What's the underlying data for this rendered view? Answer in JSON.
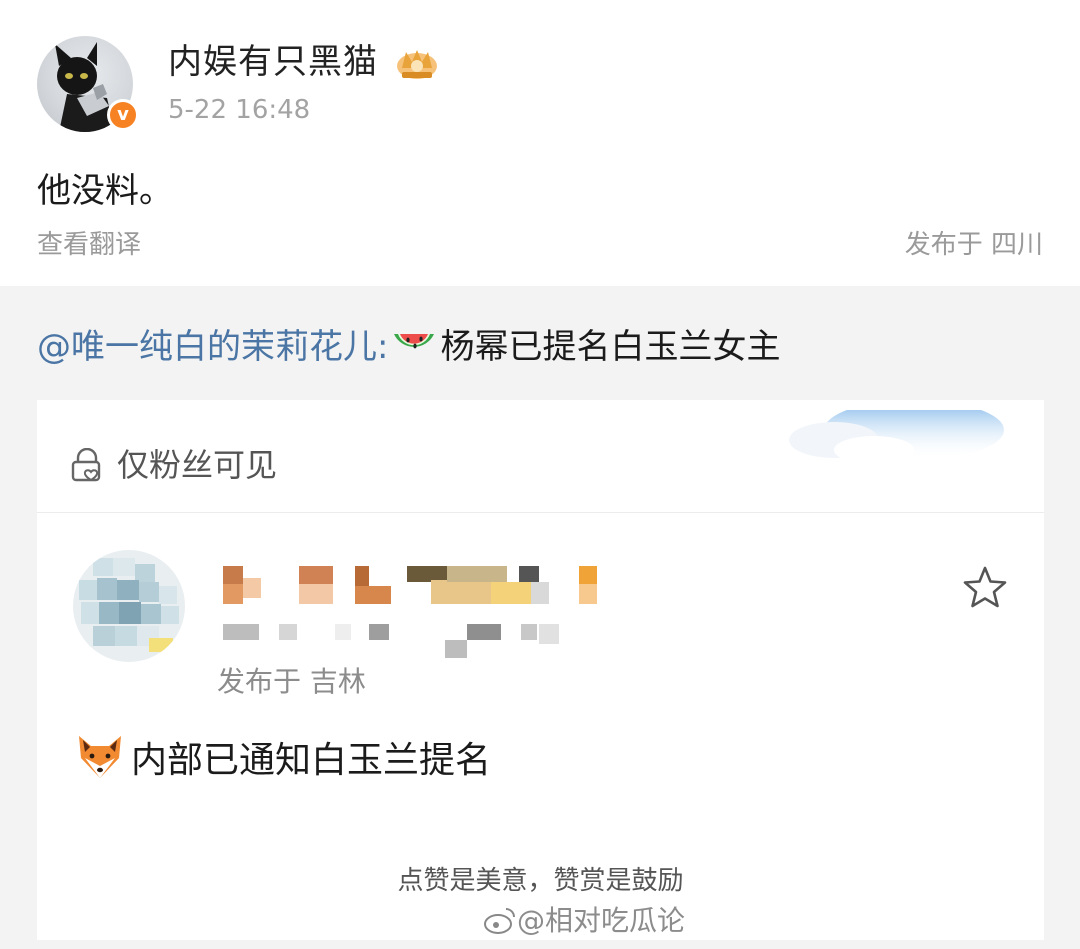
{
  "post": {
    "username": "内娱有只黑猫",
    "time": "5-22 16:48",
    "badge": "v",
    "text": "他没料。",
    "translate": "查看翻译",
    "location": "发布于 四川"
  },
  "repost": {
    "mention": "@唯一纯白的茉莉花儿:",
    "text": "杨幂已提名白玉兰女主"
  },
  "card": {
    "fans_only": "仅粉丝可见",
    "location": "发布于 吉林",
    "text": "内部已通知白玉兰提名",
    "appreciate": "点赞是美意，赞赏是鼓励",
    "watermark": "@相对吃瓜论"
  },
  "colors": {
    "mention": "#4a75a4",
    "badge": "#f78223",
    "muted": "#9a9a9a",
    "background": "#f3f3f3"
  },
  "icons": [
    "black-cat-avatar",
    "verified-badge-icon",
    "crown-icon",
    "watermelon-icon",
    "lock-heart-icon",
    "star-icon",
    "fox-icon",
    "weibo-logo-icon"
  ]
}
